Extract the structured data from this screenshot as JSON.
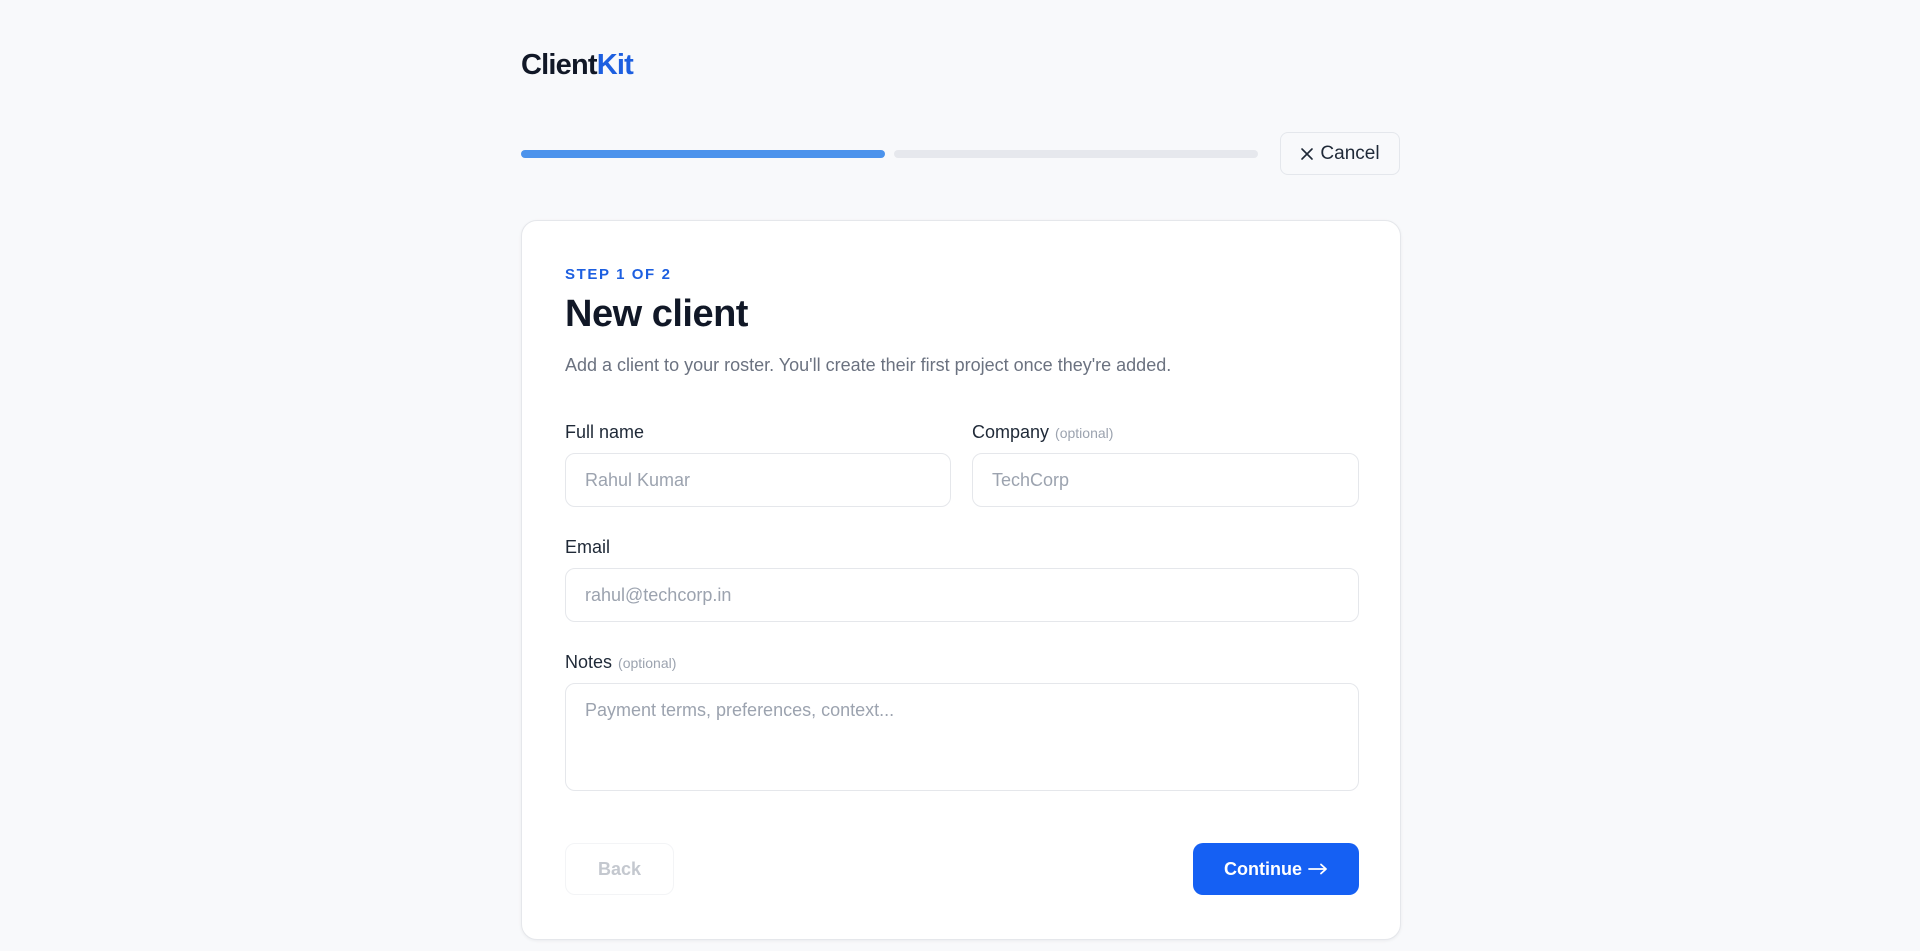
{
  "brand": {
    "name_part1": "Client",
    "name_part2": "Kit",
    "accent_color": "#1d5fe0"
  },
  "progress": {
    "current_step": 1,
    "total_steps": 2,
    "fraction_complete": 0.5,
    "fill_color": "#4c93ec"
  },
  "header": {
    "cancel_label": "Cancel",
    "cancel_icon": "close-icon"
  },
  "form": {
    "step_label": "STEP 1 OF 2",
    "title": "New client",
    "subtitle": "Add a client to your roster. You'll create their first project once they're added.",
    "optional_tag": "(optional)",
    "fields": {
      "full_name": {
        "label": "Full name",
        "value": "",
        "placeholder": "Rahul Kumar"
      },
      "company": {
        "label": "Company",
        "value": "",
        "placeholder": "TechCorp"
      },
      "email": {
        "label": "Email",
        "value": "",
        "placeholder": "rahul@techcorp.in"
      },
      "notes": {
        "label": "Notes",
        "value": "",
        "placeholder": "Payment terms, preferences, context..."
      }
    },
    "back_label": "Back",
    "continue_label": "Continue",
    "continue_icon": "arrow-right-icon",
    "primary_color": "#1560f3"
  }
}
